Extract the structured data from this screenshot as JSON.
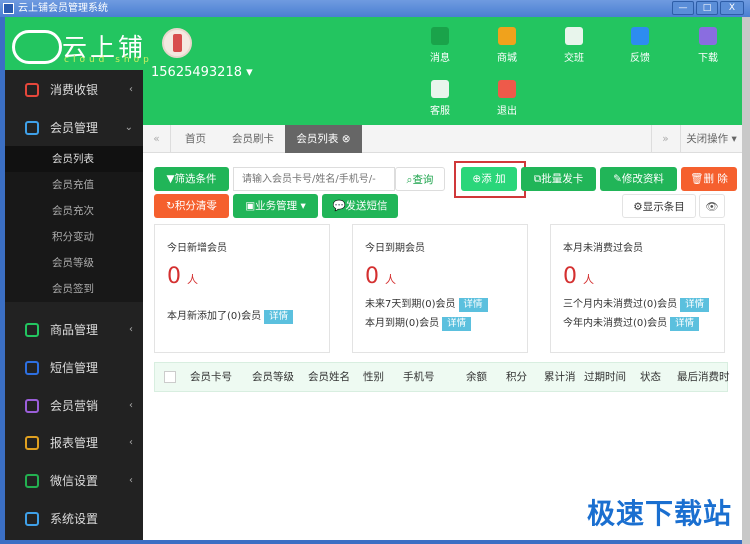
{
  "window": {
    "title": "云上铺会员管理系统",
    "minimize": "—",
    "maximize": "□",
    "close": "X"
  },
  "brand": {
    "name": "云上铺",
    "sub": "cloud shop"
  },
  "user": {
    "phone": "15625493218"
  },
  "header_icons": [
    {
      "label": "消息",
      "icon": "paper-plane-icon",
      "color": "#1aa34a"
    },
    {
      "label": "商城",
      "icon": "shop-bag-icon",
      "color": "#f0a21c"
    },
    {
      "label": "交班",
      "icon": "swap-icon",
      "color": "#e8f5ec"
    },
    {
      "label": "反馈",
      "icon": "chat-bubble-icon",
      "color": "#2d8cf0"
    },
    {
      "label": "下载",
      "icon": "download-icon",
      "color": "#8a6de0"
    },
    {
      "label": "客服",
      "icon": "customer-service-icon",
      "color": "#e8f5ec"
    },
    {
      "label": "退出",
      "icon": "power-icon",
      "color": "#ee5a4a"
    }
  ],
  "sidebar": {
    "items": [
      {
        "label": "消费收银",
        "icon": "cashier-icon",
        "color": "#e5473b",
        "arrow": "‹"
      },
      {
        "label": "会员管理",
        "icon": "members-icon",
        "color": "#3fa0e8",
        "arrow": "⌄"
      },
      {
        "label": "商品管理",
        "icon": "goods-icon",
        "color": "#23c560",
        "arrow": "‹"
      },
      {
        "label": "短信管理",
        "icon": "sms-icon",
        "color": "#2d6fe0",
        "arrow": ""
      },
      {
        "label": "会员营销",
        "icon": "gift-icon",
        "color": "#9a5ed8",
        "arrow": "‹"
      },
      {
        "label": "报表管理",
        "icon": "report-icon",
        "color": "#e0a020",
        "arrow": "‹"
      },
      {
        "label": "微信设置",
        "icon": "wechat-icon",
        "color": "#23b050",
        "arrow": "‹"
      },
      {
        "label": "系统设置",
        "icon": "gear-icon",
        "color": "#3fa0e8",
        "arrow": ""
      }
    ],
    "subitems": [
      "会员列表",
      "会员充值",
      "会员充次",
      "积分变动",
      "会员等级",
      "会员签到"
    ]
  },
  "tabs": {
    "prev": "«",
    "items": [
      "首页",
      "会员刷卡",
      "会员列表"
    ],
    "next": "»",
    "close_ops": "关闭操作 ▾"
  },
  "toolbar": {
    "filter": "筛选条件",
    "search_placeholder": "请输入会员卡号/姓名/手机号/-",
    "query": "查询",
    "add": "添 加",
    "batch_card": "批量发卡",
    "edit": "修改资料",
    "delete": "删 除",
    "clear_points": "积分清零",
    "business": "业务管理 ▾",
    "send_sms": "发送短信",
    "display_items": "显示条目"
  },
  "cards": [
    {
      "title": "今日新增会员",
      "value": "0",
      "unit": "人",
      "lines": [
        {
          "text": "本月新添加了(0)会员",
          "tag": "详情"
        }
      ]
    },
    {
      "title": "今日到期会员",
      "value": "0",
      "unit": "人",
      "lines": [
        {
          "text": "未来7天到期(0)会员",
          "tag": "详情"
        },
        {
          "text": "本月到期(0)会员",
          "tag": "详情"
        }
      ]
    },
    {
      "title": "本月未消费过会员",
      "value": "0",
      "unit": "人",
      "lines": [
        {
          "text": "三个月内未消费过(0)会员",
          "tag": "详情"
        },
        {
          "text": "今年内未消费过(0)会员",
          "tag": "详情"
        }
      ]
    }
  ],
  "table": {
    "columns": [
      "会员卡号",
      "会员等级",
      "会员姓名",
      "性别",
      "手机号",
      "余额",
      "积分",
      "累计消",
      "过期时间",
      "状态",
      "最后消费时"
    ]
  },
  "watermark": "极速下载站"
}
